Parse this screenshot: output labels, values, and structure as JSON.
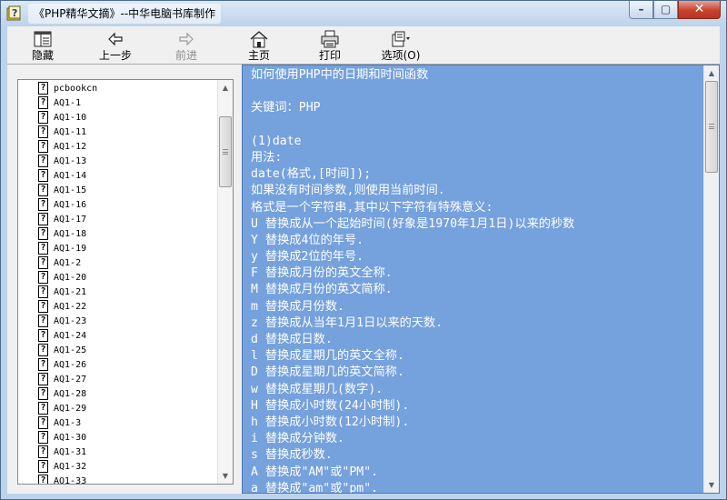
{
  "window": {
    "title": "《PHP精华文摘》--中华电脑书库制作",
    "controls": {
      "minimize": "–",
      "maximize": "▢",
      "close": "✕"
    }
  },
  "toolbar": {
    "hide": {
      "label": "隐藏",
      "icon": "hide-pane-icon"
    },
    "back": {
      "label": "上一步",
      "icon": "arrow-left-icon"
    },
    "forward": {
      "label": "前进",
      "icon": "arrow-right-icon",
      "disabled": true
    },
    "home": {
      "label": "主页",
      "icon": "home-icon"
    },
    "print": {
      "label": "打印",
      "icon": "printer-icon"
    },
    "options": {
      "label": "选项(O)",
      "icon": "options-icon"
    }
  },
  "tree": {
    "items": [
      "pcbookcn",
      "AQ1-1",
      "AQ1-10",
      "AQ1-11",
      "AQ1-12",
      "AQ1-13",
      "AQ1-14",
      "AQ1-15",
      "AQ1-16",
      "AQ1-17",
      "AQ1-18",
      "AQ1-19",
      "AQ1-2",
      "AQ1-20",
      "AQ1-21",
      "AQ1-22",
      "AQ1-23",
      "AQ1-24",
      "AQ1-25",
      "AQ1-26",
      "AQ1-27",
      "AQ1-28",
      "AQ1-29",
      "AQ1-3",
      "AQ1-30",
      "AQ1-31",
      "AQ1-32",
      "AQ1-33"
    ],
    "item_icon": "help-topic-icon",
    "scroll": {
      "thumb_start": 0.055,
      "thumb_fraction": 0.19
    }
  },
  "document": {
    "lines": [
      "如何使用PHP中的日期和时间函数",
      "",
      "关键词：PHP",
      "",
      "(1)date",
      "用法:",
      "date(格式,[时间]);",
      "如果没有时间参数,则使用当前时间.",
      "格式是一个字符串,其中以下字符有特殊意义:",
      "U 替换成从一个起始时间(好象是1970年1月1日)以来的秒数",
      "Y 替换成4位的年号.",
      "y 替换成2位的年号.",
      "F 替换成月份的英文全称.",
      "M 替换成月份的英文简称.",
      "m 替换成月份数.",
      "z 替换成从当年1月1日以来的天数.",
      "d 替换成日数.",
      "l 替换成星期几的英文全称.",
      "D 替换成星期几的英文简称.",
      "w 替换成星期几(数字).",
      "H 替换成小时数(24小时制).",
      "h 替换成小时数(12小时制).",
      "i 替换成分钟数.",
      "s 替换成秒数.",
      "A 替换成\"AM\"或\"PM\".",
      "a 替换成\"am\"或\"pm\"."
    ],
    "background": "#75a1dd",
    "scroll": {
      "thumb_start": 0.0,
      "thumb_fraction": 0.23
    }
  }
}
